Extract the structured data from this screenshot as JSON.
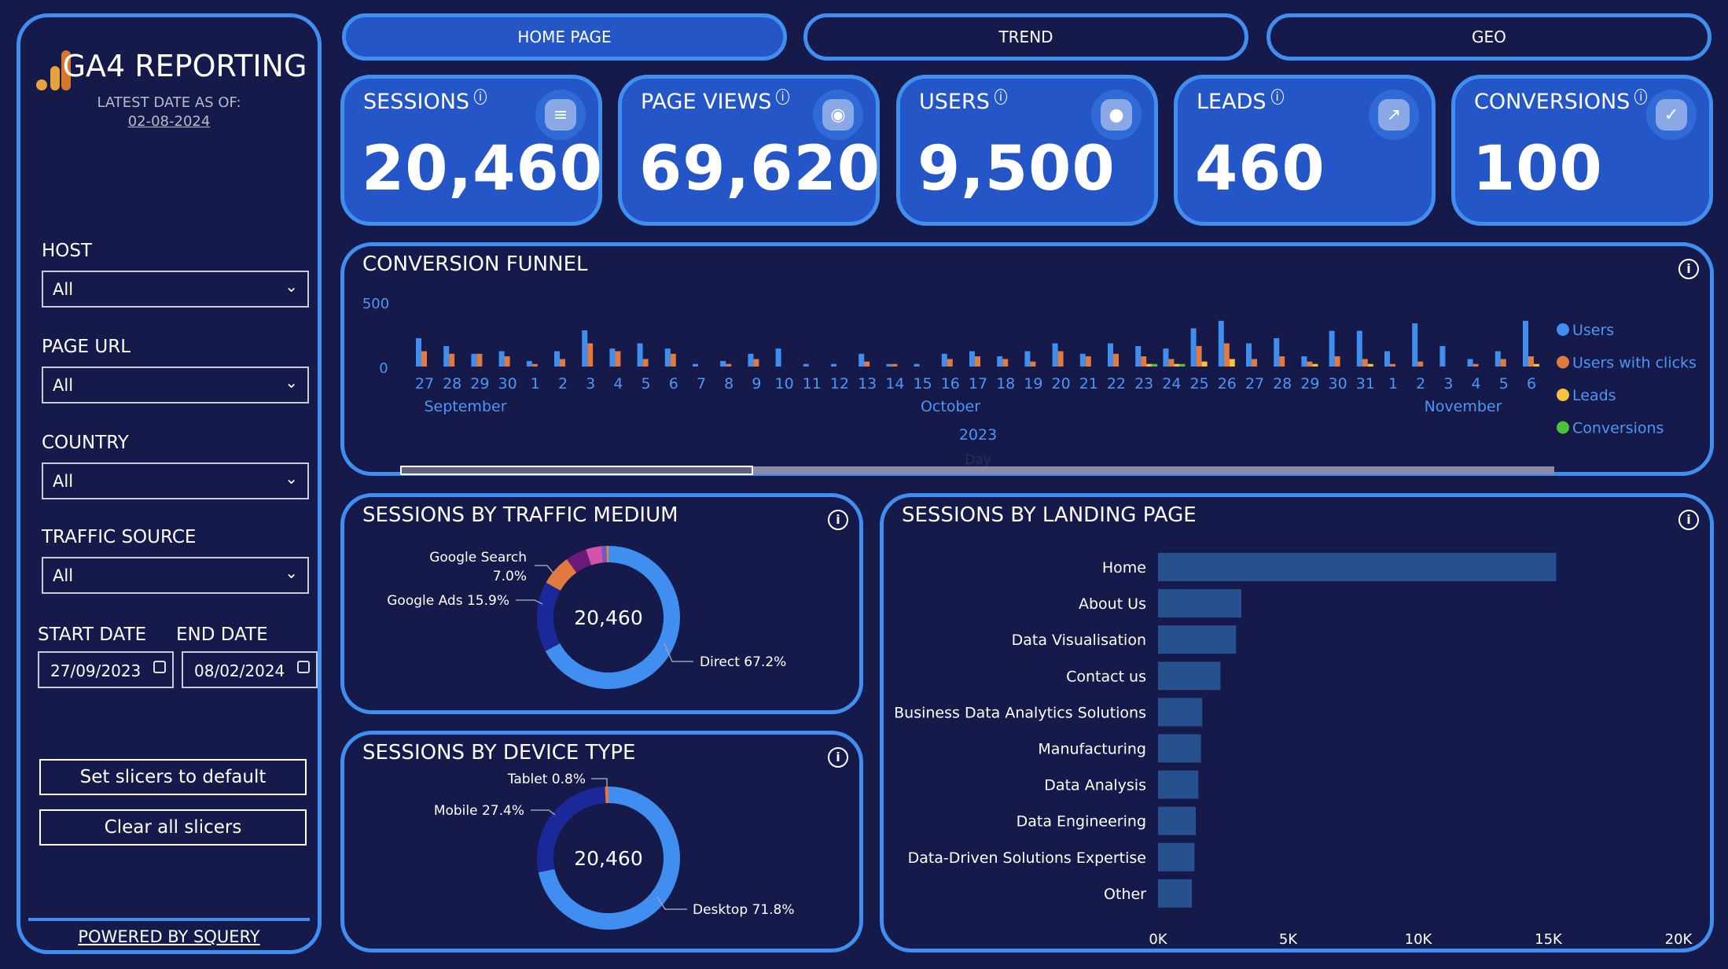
{
  "sidebar": {
    "title": "GA4 REPORTING",
    "latest_label": "LATEST DATE AS OF:",
    "latest_date": "02-08-2024",
    "filters": [
      {
        "label": "HOST",
        "value": "All"
      },
      {
        "label": "PAGE URL",
        "value": "All"
      },
      {
        "label": "COUNTRY",
        "value": "All"
      },
      {
        "label": "TRAFFIC SOURCE",
        "value": "All"
      }
    ],
    "start_label": "START DATE",
    "end_label": "END DATE",
    "start_date": "27/09/2023",
    "end_date": "08/02/2024",
    "reset_button": "Set slicers to default",
    "clear_button": "Clear all slicers",
    "powered": "POWERED BY SQUERY"
  },
  "tabs": [
    {
      "label": "HOME PAGE",
      "active": true
    },
    {
      "label": "TREND",
      "active": false
    },
    {
      "label": "GEO",
      "active": false
    }
  ],
  "kpis": [
    {
      "title": "SESSIONS",
      "value": "20,460",
      "icon": "list-icon"
    },
    {
      "title": "PAGE VIEWS",
      "value": "69,620",
      "icon": "eye-icon"
    },
    {
      "title": "USERS",
      "value": "9,500",
      "icon": "users-icon"
    },
    {
      "title": "LEADS",
      "value": "460",
      "icon": "trend-icon"
    },
    {
      "title": "CONVERSIONS",
      "value": "100",
      "icon": "check-icon"
    }
  ],
  "colors": {
    "users": "#3f8ef0",
    "clicks": "#e07a3f",
    "leads": "#f5c242",
    "conversions": "#4cc23a",
    "bar": "#27508f"
  },
  "chart_data": [
    {
      "type": "bar",
      "title": "CONVERSION FUNNEL",
      "yticks": [
        "500",
        "0"
      ],
      "ylim": [
        0,
        500
      ],
      "categories": [
        "27",
        "28",
        "29",
        "30",
        "1",
        "2",
        "3",
        "4",
        "5",
        "6",
        "7",
        "8",
        "9",
        "10",
        "11",
        "12",
        "13",
        "14",
        "15",
        "16",
        "17",
        "18",
        "19",
        "20",
        "21",
        "22",
        "23",
        "24",
        "25",
        "26",
        "27",
        "28",
        "29",
        "30",
        "31",
        "1",
        "2",
        "3",
        "4",
        "5",
        "6"
      ],
      "months": [
        "September",
        "October",
        "November"
      ],
      "year": "2023",
      "axis_title": "Day",
      "series": [
        {
          "name": "Users",
          "values": [
            222,
            161,
            100,
            120,
            43,
            120,
            284,
            141,
            182,
            141,
            20,
            43,
            100,
            141,
            20,
            20,
            100,
            20,
            20,
            100,
            120,
            80,
            120,
            182,
            100,
            182,
            161,
            141,
            300,
            359,
            182,
            222,
            80,
            280,
            280,
            120,
            339,
            161,
            59,
            120,
            359
          ]
        },
        {
          "name": "Users with clicks",
          "values": [
            120,
            100,
            100,
            80,
            20,
            59,
            182,
            120,
            59,
            100,
            0,
            20,
            59,
            0,
            0,
            0,
            39,
            20,
            0,
            59,
            80,
            59,
            39,
            120,
            80,
            100,
            80,
            59,
            161,
            182,
            59,
            80,
            39,
            80,
            59,
            20,
            39,
            0,
            20,
            59,
            80
          ]
        },
        {
          "name": "Leads",
          "values": [
            0,
            0,
            0,
            0,
            0,
            0,
            0,
            0,
            0,
            0,
            0,
            0,
            0,
            0,
            0,
            0,
            0,
            0,
            0,
            0,
            0,
            0,
            0,
            0,
            0,
            0,
            20,
            20,
            39,
            59,
            0,
            0,
            20,
            0,
            20,
            0,
            0,
            0,
            0,
            0,
            20
          ]
        },
        {
          "name": "Conversions",
          "values": [
            0,
            0,
            0,
            0,
            0,
            0,
            0,
            0,
            0,
            0,
            0,
            0,
            0,
            0,
            0,
            0,
            0,
            0,
            0,
            0,
            0,
            0,
            0,
            0,
            0,
            0,
            20,
            20,
            0,
            0,
            0,
            0,
            0,
            0,
            0,
            0,
            0,
            0,
            0,
            0,
            0
          ]
        }
      ]
    },
    {
      "type": "pie",
      "title": "SESSIONS BY TRAFFIC MEDIUM",
      "center": "20,460",
      "slices": [
        {
          "label": "Direct 67.2%",
          "value": 67.2,
          "color": "#3f8ef0"
        },
        {
          "label": "Google Ads 15.9%",
          "value": 15.9,
          "color": "#1a2899"
        },
        {
          "label": "Google Search",
          "label2": "7.0%",
          "value": 7.0,
          "color": "#e07a3f"
        },
        {
          "value": 4.8,
          "color": "#6b1a7a"
        },
        {
          "value": 3.6,
          "color": "#d254a8"
        },
        {
          "value": 1.0,
          "color": "#6a5acd"
        },
        {
          "value": 0.5,
          "color": "#e08a30"
        }
      ]
    },
    {
      "type": "pie",
      "title": "SESSIONS BY DEVICE TYPE",
      "center": "20,460",
      "slices": [
        {
          "label": "Desktop 71.8%",
          "value": 71.8,
          "color": "#3f8ef0"
        },
        {
          "label": "Mobile 27.4%",
          "value": 27.4,
          "color": "#1a2899"
        },
        {
          "label": "Tablet 0.8%",
          "value": 0.8,
          "color": "#e07a3f"
        }
      ]
    },
    {
      "type": "bar",
      "orientation": "horizontal",
      "title": "SESSIONS BY LANDING PAGE",
      "xlim": [
        0,
        20000
      ],
      "xticks": [
        "0K",
        "5K",
        "10K",
        "15K",
        "20K"
      ],
      "categories": [
        "Home",
        "About Us",
        "Data Visualisation",
        "Contact us",
        "Business Data Analytics Solutions",
        "Manufacturing",
        "Data Analysis",
        "Data Engineering",
        "Data-Driven Solutions Expertise",
        "Other"
      ],
      "values": [
        15300,
        3200,
        3000,
        2400,
        1700,
        1650,
        1550,
        1450,
        1400,
        1300
      ]
    }
  ]
}
